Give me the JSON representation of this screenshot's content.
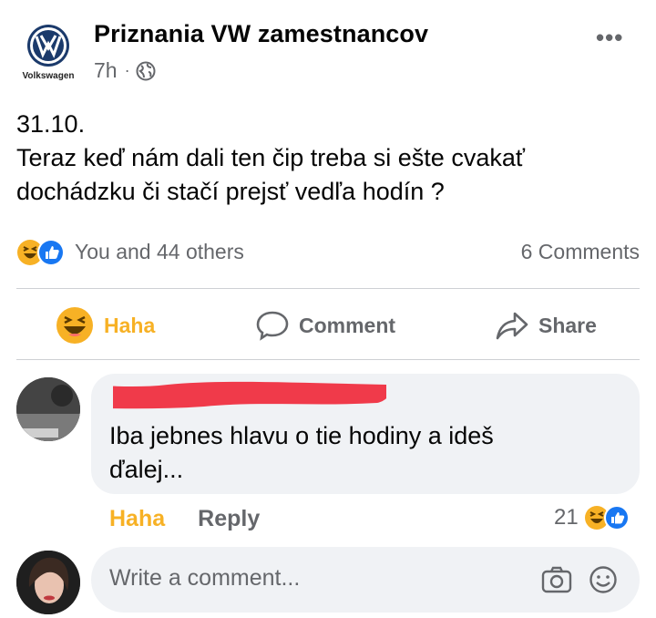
{
  "post": {
    "page_name": "Priznania VW zamestnancov",
    "page_avatar_logo_text": "Volkswagen",
    "time": "7h",
    "separator": "·",
    "privacy_icon": "globe-icon",
    "more_icon": "•••",
    "text_lines": [
      "31.10.",
      "Teraz keď nám dali ten čip treba si ešte cvakať",
      "dochádzku či stačí prejsť vedľa hodín ?"
    ],
    "reactions_summary": "You and 44 others",
    "reaction_icons": [
      "haha-icon",
      "like-icon"
    ],
    "comments_count": "6 Comments"
  },
  "actions": {
    "haha": "Haha",
    "comment": "Comment",
    "share": "Share"
  },
  "comment": {
    "text_lines": [
      "Iba jebnes hlavu o tie hodiny a ideš",
      "ďalej..."
    ],
    "haha_label": "Haha",
    "reply_label": "Reply",
    "reaction_count": "21",
    "reaction_icons": [
      "haha-icon",
      "like-icon"
    ]
  },
  "composer": {
    "placeholder": "Write a comment...",
    "icons": [
      "camera-icon",
      "emoji-icon"
    ]
  },
  "colors": {
    "haha_yellow": "#f7b125",
    "like_blue": "#1877f2",
    "text_secondary": "#65676b",
    "bubble_bg": "#f0f2f5",
    "redaction_red": "#f03a4a"
  }
}
